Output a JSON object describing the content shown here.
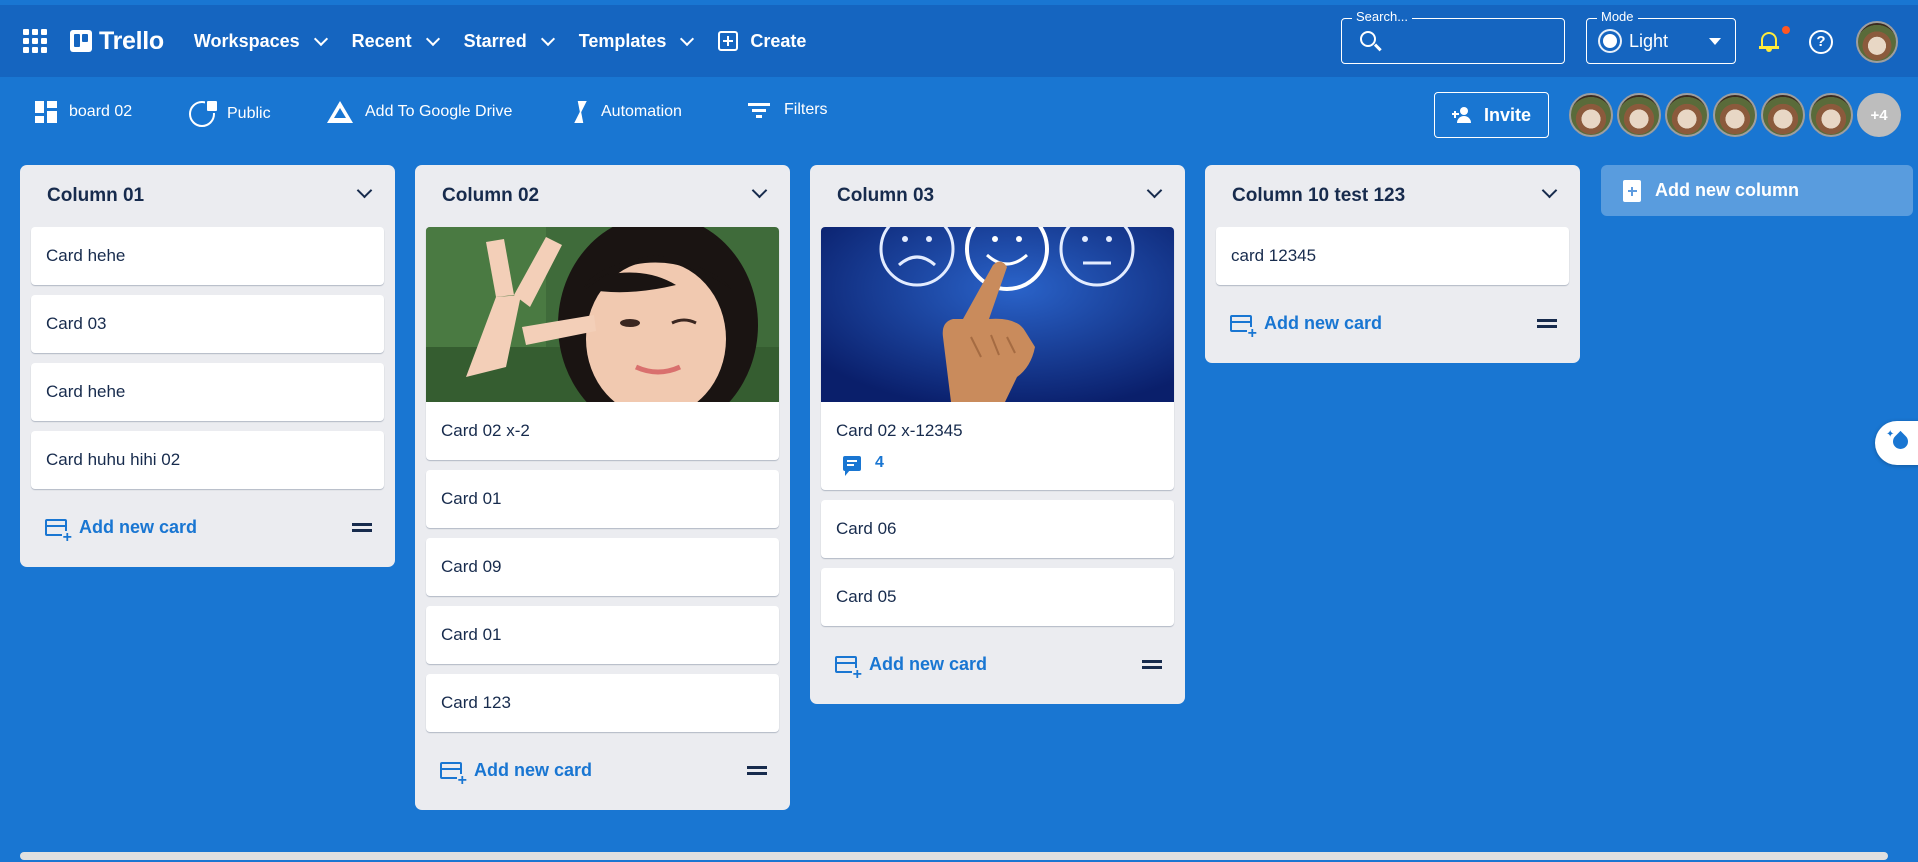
{
  "app": {
    "name": "Trello",
    "nav": [
      {
        "label": "Workspaces"
      },
      {
        "label": "Recent"
      },
      {
        "label": "Starred"
      },
      {
        "label": "Templates"
      }
    ],
    "create_label": "Create",
    "search_label": "Search...",
    "mode_label": "Mode",
    "mode_value": "Light"
  },
  "board": {
    "title": "board 02",
    "visibility": "Public",
    "drive": "Add To Google Drive",
    "automation": "Automation",
    "filters": "Filters",
    "invite": "Invite",
    "extra_members": "+4"
  },
  "columns": [
    {
      "title": "Column 01",
      "cards": [
        {
          "title": "Card hehe"
        },
        {
          "title": "Card 03"
        },
        {
          "title": "Card hehe"
        },
        {
          "title": "Card huhu hihi 02"
        }
      ]
    },
    {
      "title": "Column 02",
      "cards": [
        {
          "title": "Card 02 x-2",
          "cover": "photo"
        },
        {
          "title": "Card 01"
        },
        {
          "title": "Card 09"
        },
        {
          "title": "Card 01"
        },
        {
          "title": "Card 123"
        }
      ]
    },
    {
      "title": "Column 03",
      "cards": [
        {
          "title": "Card 02 x-12345",
          "cover": "smileys",
          "comments": "4"
        },
        {
          "title": "Card 06"
        },
        {
          "title": "Card 05"
        }
      ]
    },
    {
      "title": "Column 10 test 123",
      "cards": [
        {
          "title": "card 12345"
        }
      ]
    }
  ],
  "add_card_label": "Add new card",
  "add_column_label": "Add new column",
  "colors": {
    "background": "#1976d2",
    "appbar": "#1565c0",
    "column": "#ebecf0",
    "accent": "#1976d2",
    "notification": "#ffeb3b"
  }
}
